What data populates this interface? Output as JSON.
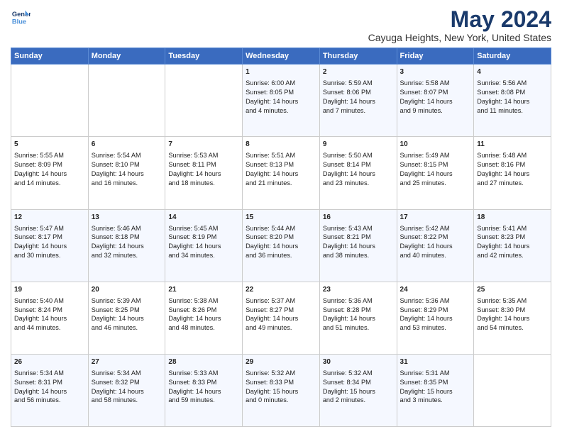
{
  "header": {
    "logo_line1": "General",
    "logo_line2": "Blue",
    "title": "May 2024",
    "subtitle": "Cayuga Heights, New York, United States"
  },
  "weekdays": [
    "Sunday",
    "Monday",
    "Tuesday",
    "Wednesday",
    "Thursday",
    "Friday",
    "Saturday"
  ],
  "weeks": [
    [
      {
        "day": "",
        "text": ""
      },
      {
        "day": "",
        "text": ""
      },
      {
        "day": "",
        "text": ""
      },
      {
        "day": "1",
        "text": "Sunrise: 6:00 AM\nSunset: 8:05 PM\nDaylight: 14 hours\nand 4 minutes."
      },
      {
        "day": "2",
        "text": "Sunrise: 5:59 AM\nSunset: 8:06 PM\nDaylight: 14 hours\nand 7 minutes."
      },
      {
        "day": "3",
        "text": "Sunrise: 5:58 AM\nSunset: 8:07 PM\nDaylight: 14 hours\nand 9 minutes."
      },
      {
        "day": "4",
        "text": "Sunrise: 5:56 AM\nSunset: 8:08 PM\nDaylight: 14 hours\nand 11 minutes."
      }
    ],
    [
      {
        "day": "5",
        "text": "Sunrise: 5:55 AM\nSunset: 8:09 PM\nDaylight: 14 hours\nand 14 minutes."
      },
      {
        "day": "6",
        "text": "Sunrise: 5:54 AM\nSunset: 8:10 PM\nDaylight: 14 hours\nand 16 minutes."
      },
      {
        "day": "7",
        "text": "Sunrise: 5:53 AM\nSunset: 8:11 PM\nDaylight: 14 hours\nand 18 minutes."
      },
      {
        "day": "8",
        "text": "Sunrise: 5:51 AM\nSunset: 8:13 PM\nDaylight: 14 hours\nand 21 minutes."
      },
      {
        "day": "9",
        "text": "Sunrise: 5:50 AM\nSunset: 8:14 PM\nDaylight: 14 hours\nand 23 minutes."
      },
      {
        "day": "10",
        "text": "Sunrise: 5:49 AM\nSunset: 8:15 PM\nDaylight: 14 hours\nand 25 minutes."
      },
      {
        "day": "11",
        "text": "Sunrise: 5:48 AM\nSunset: 8:16 PM\nDaylight: 14 hours\nand 27 minutes."
      }
    ],
    [
      {
        "day": "12",
        "text": "Sunrise: 5:47 AM\nSunset: 8:17 PM\nDaylight: 14 hours\nand 30 minutes."
      },
      {
        "day": "13",
        "text": "Sunrise: 5:46 AM\nSunset: 8:18 PM\nDaylight: 14 hours\nand 32 minutes."
      },
      {
        "day": "14",
        "text": "Sunrise: 5:45 AM\nSunset: 8:19 PM\nDaylight: 14 hours\nand 34 minutes."
      },
      {
        "day": "15",
        "text": "Sunrise: 5:44 AM\nSunset: 8:20 PM\nDaylight: 14 hours\nand 36 minutes."
      },
      {
        "day": "16",
        "text": "Sunrise: 5:43 AM\nSunset: 8:21 PM\nDaylight: 14 hours\nand 38 minutes."
      },
      {
        "day": "17",
        "text": "Sunrise: 5:42 AM\nSunset: 8:22 PM\nDaylight: 14 hours\nand 40 minutes."
      },
      {
        "day": "18",
        "text": "Sunrise: 5:41 AM\nSunset: 8:23 PM\nDaylight: 14 hours\nand 42 minutes."
      }
    ],
    [
      {
        "day": "19",
        "text": "Sunrise: 5:40 AM\nSunset: 8:24 PM\nDaylight: 14 hours\nand 44 minutes."
      },
      {
        "day": "20",
        "text": "Sunrise: 5:39 AM\nSunset: 8:25 PM\nDaylight: 14 hours\nand 46 minutes."
      },
      {
        "day": "21",
        "text": "Sunrise: 5:38 AM\nSunset: 8:26 PM\nDaylight: 14 hours\nand 48 minutes."
      },
      {
        "day": "22",
        "text": "Sunrise: 5:37 AM\nSunset: 8:27 PM\nDaylight: 14 hours\nand 49 minutes."
      },
      {
        "day": "23",
        "text": "Sunrise: 5:36 AM\nSunset: 8:28 PM\nDaylight: 14 hours\nand 51 minutes."
      },
      {
        "day": "24",
        "text": "Sunrise: 5:36 AM\nSunset: 8:29 PM\nDaylight: 14 hours\nand 53 minutes."
      },
      {
        "day": "25",
        "text": "Sunrise: 5:35 AM\nSunset: 8:30 PM\nDaylight: 14 hours\nand 54 minutes."
      }
    ],
    [
      {
        "day": "26",
        "text": "Sunrise: 5:34 AM\nSunset: 8:31 PM\nDaylight: 14 hours\nand 56 minutes."
      },
      {
        "day": "27",
        "text": "Sunrise: 5:34 AM\nSunset: 8:32 PM\nDaylight: 14 hours\nand 58 minutes."
      },
      {
        "day": "28",
        "text": "Sunrise: 5:33 AM\nSunset: 8:33 PM\nDaylight: 14 hours\nand 59 minutes."
      },
      {
        "day": "29",
        "text": "Sunrise: 5:32 AM\nSunset: 8:33 PM\nDaylight: 15 hours\nand 0 minutes."
      },
      {
        "day": "30",
        "text": "Sunrise: 5:32 AM\nSunset: 8:34 PM\nDaylight: 15 hours\nand 2 minutes."
      },
      {
        "day": "31",
        "text": "Sunrise: 5:31 AM\nSunset: 8:35 PM\nDaylight: 15 hours\nand 3 minutes."
      },
      {
        "day": "",
        "text": ""
      }
    ]
  ]
}
